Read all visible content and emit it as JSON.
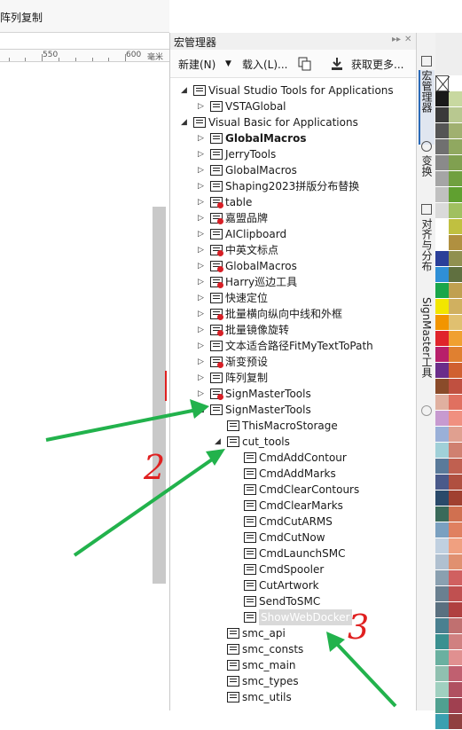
{
  "left": {
    "toolbar_text": "阵列复制",
    "ruler_labels": [
      "550",
      "600",
      "毫米"
    ]
  },
  "docker": {
    "title": "宏管理器",
    "toolbar": {
      "new_label": "新建(N)",
      "load_label": "载入(L)...",
      "get_more_label": "获取更多..."
    }
  },
  "tree": [
    {
      "label": "Visual Studio Tools for Applications",
      "indent": 0,
      "expander": "open",
      "icon": "project",
      "red": false,
      "bold": false
    },
    {
      "label": "VSTAGlobal",
      "indent": 1,
      "expander": "closed",
      "icon": "gear",
      "red": false,
      "bold": false
    },
    {
      "label": "Visual Basic for Applications",
      "indent": 0,
      "expander": "open",
      "icon": "project",
      "red": false,
      "bold": false
    },
    {
      "label": "GlobalMacros",
      "indent": 1,
      "expander": "closed",
      "icon": "module",
      "red": false,
      "bold": true
    },
    {
      "label": "JerryTools",
      "indent": 1,
      "expander": "closed",
      "icon": "module",
      "red": false,
      "bold": false
    },
    {
      "label": "GlobalMacros",
      "indent": 1,
      "expander": "closed",
      "icon": "module",
      "red": false,
      "bold": false
    },
    {
      "label": "Shaping2023拼版分布替换",
      "indent": 1,
      "expander": "closed",
      "icon": "module",
      "red": false,
      "bold": false
    },
    {
      "label": "table",
      "indent": 1,
      "expander": "closed",
      "icon": "module",
      "red": true,
      "bold": false
    },
    {
      "label": "嘉盟品牌",
      "indent": 1,
      "expander": "closed",
      "icon": "module",
      "red": true,
      "bold": false
    },
    {
      "label": "AIClipboard",
      "indent": 1,
      "expander": "closed",
      "icon": "module",
      "red": false,
      "bold": false
    },
    {
      "label": "中英文标点",
      "indent": 1,
      "expander": "closed",
      "icon": "module",
      "red": true,
      "bold": false
    },
    {
      "label": "GlobalMacros",
      "indent": 1,
      "expander": "closed",
      "icon": "module",
      "red": true,
      "bold": false
    },
    {
      "label": "Harry巡边工具",
      "indent": 1,
      "expander": "closed",
      "icon": "module",
      "red": true,
      "bold": false
    },
    {
      "label": "快速定位",
      "indent": 1,
      "expander": "closed",
      "icon": "module",
      "red": false,
      "bold": false
    },
    {
      "label": "批量横向纵向中线和外框",
      "indent": 1,
      "expander": "closed",
      "icon": "module",
      "red": true,
      "bold": false
    },
    {
      "label": "批量镜像旋转",
      "indent": 1,
      "expander": "closed",
      "icon": "module",
      "red": true,
      "bold": false
    },
    {
      "label": "文本适合路径FitMyTextToPath",
      "indent": 1,
      "expander": "closed",
      "icon": "module",
      "red": false,
      "bold": false
    },
    {
      "label": "渐变预设",
      "indent": 1,
      "expander": "closed",
      "icon": "module",
      "red": true,
      "bold": false
    },
    {
      "label": "阵列复制",
      "indent": 1,
      "expander": "closed",
      "icon": "module",
      "red": false,
      "bold": false
    },
    {
      "label": "SignMasterTools",
      "indent": 1,
      "expander": "closed",
      "icon": "module",
      "red": true,
      "bold": false
    },
    {
      "label": "SignMasterTools",
      "indent": 1,
      "expander": "open",
      "icon": "module",
      "red": false,
      "bold": false
    },
    {
      "label": "ThisMacroStorage",
      "indent": 2,
      "expander": "none",
      "icon": "module",
      "red": false,
      "bold": false
    },
    {
      "label": "cut_tools",
      "indent": 2,
      "expander": "open",
      "icon": "module",
      "red": false,
      "bold": false
    },
    {
      "label": "CmdAddContour",
      "indent": 3,
      "expander": "none",
      "icon": "module",
      "red": false,
      "bold": false
    },
    {
      "label": "CmdAddMarks",
      "indent": 3,
      "expander": "none",
      "icon": "module",
      "red": false,
      "bold": false
    },
    {
      "label": "CmdClearContours",
      "indent": 3,
      "expander": "none",
      "icon": "module",
      "red": false,
      "bold": false
    },
    {
      "label": "CmdClearMarks",
      "indent": 3,
      "expander": "none",
      "icon": "module",
      "red": false,
      "bold": false
    },
    {
      "label": "CmdCutARMS",
      "indent": 3,
      "expander": "none",
      "icon": "module",
      "red": false,
      "bold": false
    },
    {
      "label": "CmdCutNow",
      "indent": 3,
      "expander": "none",
      "icon": "module",
      "red": false,
      "bold": false
    },
    {
      "label": "CmdLaunchSMC",
      "indent": 3,
      "expander": "none",
      "icon": "module",
      "red": false,
      "bold": false
    },
    {
      "label": "CmdSpooler",
      "indent": 3,
      "expander": "none",
      "icon": "module",
      "red": false,
      "bold": false
    },
    {
      "label": "CutArtwork",
      "indent": 3,
      "expander": "none",
      "icon": "module",
      "red": false,
      "bold": false
    },
    {
      "label": "SendToSMC",
      "indent": 3,
      "expander": "none",
      "icon": "module",
      "red": false,
      "bold": false
    },
    {
      "label": "ShowWebDocker",
      "indent": 3,
      "expander": "none",
      "icon": "module",
      "red": false,
      "bold": false,
      "selected": true
    },
    {
      "label": "smc_api",
      "indent": 2,
      "expander": "none",
      "icon": "module",
      "red": false,
      "bold": false
    },
    {
      "label": "smc_consts",
      "indent": 2,
      "expander": "none",
      "icon": "module",
      "red": false,
      "bold": false
    },
    {
      "label": "smc_main",
      "indent": 2,
      "expander": "none",
      "icon": "module",
      "red": false,
      "bold": false
    },
    {
      "label": "smc_types",
      "indent": 2,
      "expander": "none",
      "icon": "module",
      "red": false,
      "bold": false
    },
    {
      "label": "smc_utils",
      "indent": 2,
      "expander": "none",
      "icon": "module",
      "red": false,
      "bold": false
    }
  ],
  "vertical_tabs": [
    {
      "label": "宏管理器",
      "active": true
    },
    {
      "label": "变换",
      "active": false
    },
    {
      "label": "对齐与分布",
      "active": false
    },
    {
      "label": "SignMaster工具",
      "active": false
    }
  ],
  "palette": {
    "col_a": [
      "#ffffff",
      "#1a1a1a",
      "#3a3a3a",
      "#555555",
      "#707070",
      "#8a8a8a",
      "#a5a5a5",
      "#c0c0c0",
      "#dadada",
      "#ffffff",
      "#ffffff",
      "#2a3f99",
      "#2f8fd6",
      "#1aa64a",
      "#f2e600",
      "#f29500",
      "#e0242b",
      "#b81f6a",
      "#6a2d8a",
      "#8a4b2a",
      "#e0b0a0",
      "#c79ad0",
      "#9ab0d8",
      "#a0d0d8",
      "#5a7a9a",
      "#4a5a8a",
      "#2a4a6a",
      "#3a6a5a",
      "#7aa0c0",
      "#c0d0e0",
      "#b0c0d0",
      "#8aa0b0",
      "#6a8090",
      "#5a7080",
      "#4a8090",
      "#3a9090",
      "#6ab0a0",
      "#90c0b0",
      "#a0d0c0",
      "#50a090",
      "#3aa0b0"
    ],
    "col_b": [
      "#ffffff",
      "#c8d8a0",
      "#b8c890",
      "#a0b070",
      "#90a860",
      "#80a050",
      "#70a040",
      "#60a030",
      "#a0c060",
      "#c0c040",
      "#b09040",
      "#909050",
      "#607040",
      "#c0a050",
      "#d0b060",
      "#e0c070",
      "#f0a030",
      "#e08030",
      "#d06030",
      "#c05040",
      "#e07060",
      "#f09080",
      "#e0a090",
      "#d08070",
      "#c06050",
      "#b05040",
      "#a04030",
      "#d07050",
      "#e08060",
      "#f0a080",
      "#e09070",
      "#d06060",
      "#c05050",
      "#b04040",
      "#c07070",
      "#d08080",
      "#e09090",
      "#c06070",
      "#b05060",
      "#a04050",
      "#904040"
    ],
    "accent": "#2a6ab8"
  },
  "annotations": {
    "numbers": [
      "2",
      "3"
    ],
    "arrow_color": "#22b24c",
    "mark_color": "#e02020"
  }
}
